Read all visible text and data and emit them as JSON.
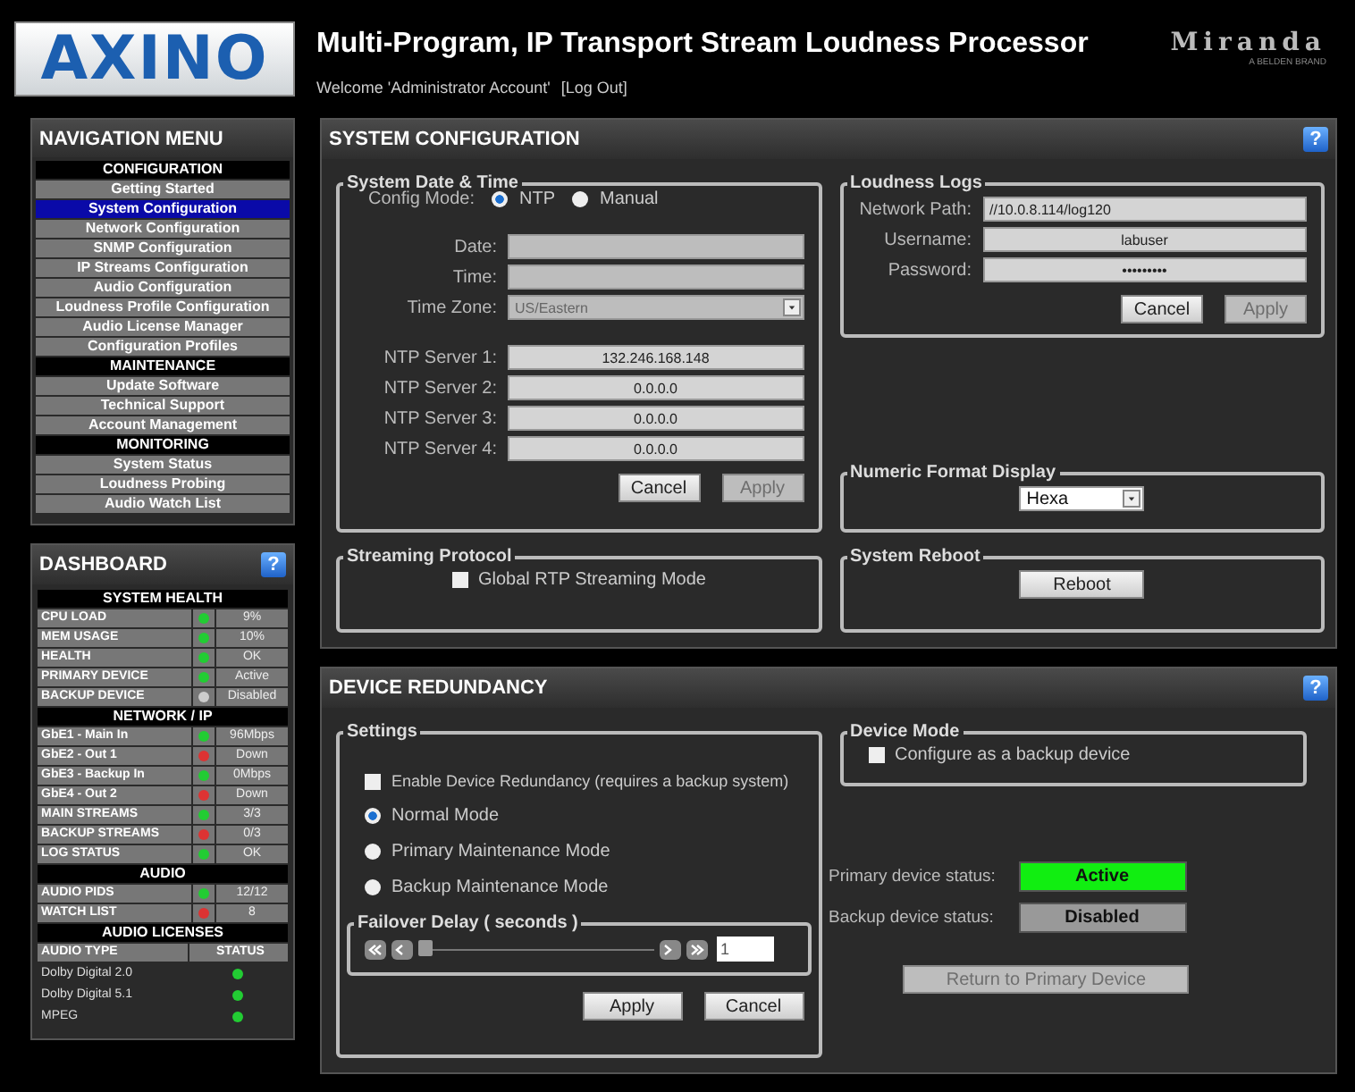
{
  "header": {
    "logo": "AXINO",
    "title": "Multi-Program, IP Transport Stream Loudness Processor",
    "welcome": "Welcome 'Administrator Account'",
    "logout": "[Log Out]",
    "brand": "Miranda",
    "brand_sub": "A BELDEN BRAND"
  },
  "navigation": {
    "title": "NAVIGATION MENU",
    "items": [
      {
        "kind": "section",
        "label": "CONFIGURATION"
      },
      {
        "kind": "link",
        "label": "Getting Started",
        "selected": false
      },
      {
        "kind": "link",
        "label": "System Configuration",
        "selected": true
      },
      {
        "kind": "link",
        "label": "Network Configuration",
        "selected": false
      },
      {
        "kind": "link",
        "label": "SNMP Configuration",
        "selected": false
      },
      {
        "kind": "link",
        "label": "IP Streams Configuration",
        "selected": false
      },
      {
        "kind": "link",
        "label": "Audio Configuration",
        "selected": false
      },
      {
        "kind": "link",
        "label": "Loudness Profile Configuration",
        "selected": false
      },
      {
        "kind": "link",
        "label": "Audio License Manager",
        "selected": false
      },
      {
        "kind": "link",
        "label": "Configuration Profiles",
        "selected": false
      },
      {
        "kind": "section",
        "label": "MAINTENANCE"
      },
      {
        "kind": "link",
        "label": "Update Software",
        "selected": false
      },
      {
        "kind": "link",
        "label": "Technical Support",
        "selected": false
      },
      {
        "kind": "link",
        "label": "Account Management",
        "selected": false
      },
      {
        "kind": "section",
        "label": "MONITORING"
      },
      {
        "kind": "link",
        "label": "System Status",
        "selected": false
      },
      {
        "kind": "link",
        "label": "Loudness Probing",
        "selected": false
      },
      {
        "kind": "link",
        "label": "Audio Watch List",
        "selected": false
      }
    ]
  },
  "dashboard": {
    "title": "DASHBOARD",
    "help": "?",
    "sections": [
      {
        "title": "SYSTEM HEALTH",
        "rows": [
          {
            "label": "CPU LOAD",
            "color": "#22cc33",
            "value": "9%"
          },
          {
            "label": "MEM USAGE",
            "color": "#22cc33",
            "value": "10%"
          },
          {
            "label": "HEALTH",
            "color": "#22cc33",
            "value": "OK"
          },
          {
            "label": "PRIMARY DEVICE",
            "color": "#22cc33",
            "value": "Active"
          },
          {
            "label": "BACKUP DEVICE",
            "color": "#cccccc",
            "value": "Disabled"
          }
        ]
      },
      {
        "title": "NETWORK / IP",
        "rows": [
          {
            "label": "GbE1 - Main In",
            "color": "#22cc33",
            "value": "96Mbps"
          },
          {
            "label": "GbE2 - Out 1",
            "color": "#dd3333",
            "value": "Down"
          },
          {
            "label": "GbE3 - Backup In",
            "color": "#22cc33",
            "value": "0Mbps"
          },
          {
            "label": "GbE4 - Out 2",
            "color": "#dd3333",
            "value": "Down"
          },
          {
            "label": "MAIN STREAMS",
            "color": "#22cc33",
            "value": "3/3"
          },
          {
            "label": "BACKUP STREAMS",
            "color": "#dd3333",
            "value": "0/3"
          },
          {
            "label": "LOG STATUS",
            "color": "#22cc33",
            "value": "OK"
          }
        ]
      },
      {
        "title": "AUDIO",
        "rows": [
          {
            "label": "AUDIO PIDS",
            "color": "#22cc33",
            "value": "12/12"
          },
          {
            "label": "WATCH LIST",
            "color": "#dd3333",
            "value": "8"
          }
        ]
      }
    ],
    "licenses": {
      "title": "AUDIO LICENSES",
      "columns": [
        "AUDIO TYPE",
        "STATUS"
      ],
      "rows": [
        {
          "name": "Dolby Digital 2.0",
          "color": "#22cc33"
        },
        {
          "name": "Dolby Digital 5.1",
          "color": "#22cc33"
        },
        {
          "name": "MPEG",
          "color": "#22cc33"
        }
      ]
    }
  },
  "system_configuration": {
    "title": "SYSTEM CONFIGURATION",
    "help": "?",
    "date_time": {
      "title": "System Date & Time",
      "config_mode_label": "Config Mode:",
      "modes": [
        {
          "label": "NTP",
          "selected": true
        },
        {
          "label": "Manual",
          "selected": false
        }
      ],
      "date_label": "Date:",
      "time_label": "Time:",
      "time_zone_label": "Time Zone:",
      "time_zone": "US/Eastern",
      "ntp_servers": [
        {
          "label": "NTP Server 1:",
          "value": "132.246.168.148"
        },
        {
          "label": "NTP Server 2:",
          "value": "0.0.0.0"
        },
        {
          "label": "NTP Server 3:",
          "value": "0.0.0.0"
        },
        {
          "label": "NTP Server 4:",
          "value": "0.0.0.0"
        }
      ],
      "buttons": [
        {
          "label": "Cancel",
          "disabled": false
        },
        {
          "label": "Apply",
          "disabled": true
        }
      ]
    },
    "loudness_logs": {
      "title": "Loudness Logs",
      "fields": [
        {
          "label": "Network Path:",
          "value": "//10.0.8.114/log120"
        },
        {
          "label": "Username:",
          "value": "labuser"
        },
        {
          "label": "Password:",
          "value": "•••••••••"
        }
      ],
      "buttons": [
        {
          "label": "Cancel",
          "disabled": false
        },
        {
          "label": "Apply",
          "disabled": true
        }
      ]
    },
    "numeric_format": {
      "title": "Numeric Format Display",
      "value": "Hexa"
    },
    "streaming_protocol": {
      "title": "Streaming Protocol",
      "option": {
        "label": "Global RTP Streaming Mode",
        "checked": false
      }
    },
    "system_reboot": {
      "title": "System Reboot",
      "button": "Reboot"
    }
  },
  "device_redundancy": {
    "title": "DEVICE REDUNDANCY",
    "help": "?",
    "settings": {
      "title": "Settings",
      "options": [
        {
          "kind": "checkbox",
          "label": "Enable Device Redundancy (requires a backup system)",
          "checked": false
        },
        {
          "kind": "radio",
          "label": "Normal Mode",
          "selected": true
        },
        {
          "kind": "radio",
          "label": "Primary Maintenance Mode",
          "selected": false
        },
        {
          "kind": "radio",
          "label": "Backup Maintenance Mode",
          "selected": false
        }
      ],
      "failover": {
        "title": "Failover Delay ( seconds )",
        "level": 0.0,
        "value": "1"
      },
      "buttons": [
        {
          "label": "Apply",
          "disabled": false
        },
        {
          "label": "Cancel",
          "disabled": false
        }
      ]
    },
    "device_mode": {
      "title": "Device Mode",
      "option": {
        "label": "Configure as a backup device",
        "checked": false
      }
    },
    "statuses": [
      {
        "label": "Primary device status:",
        "value": "Active",
        "color": "#11ee11"
      },
      {
        "label": "Backup device status:",
        "value": "Disabled",
        "color": "#999999"
      }
    ],
    "return_button": {
      "label": "Return to Primary Device",
      "disabled": true
    }
  }
}
